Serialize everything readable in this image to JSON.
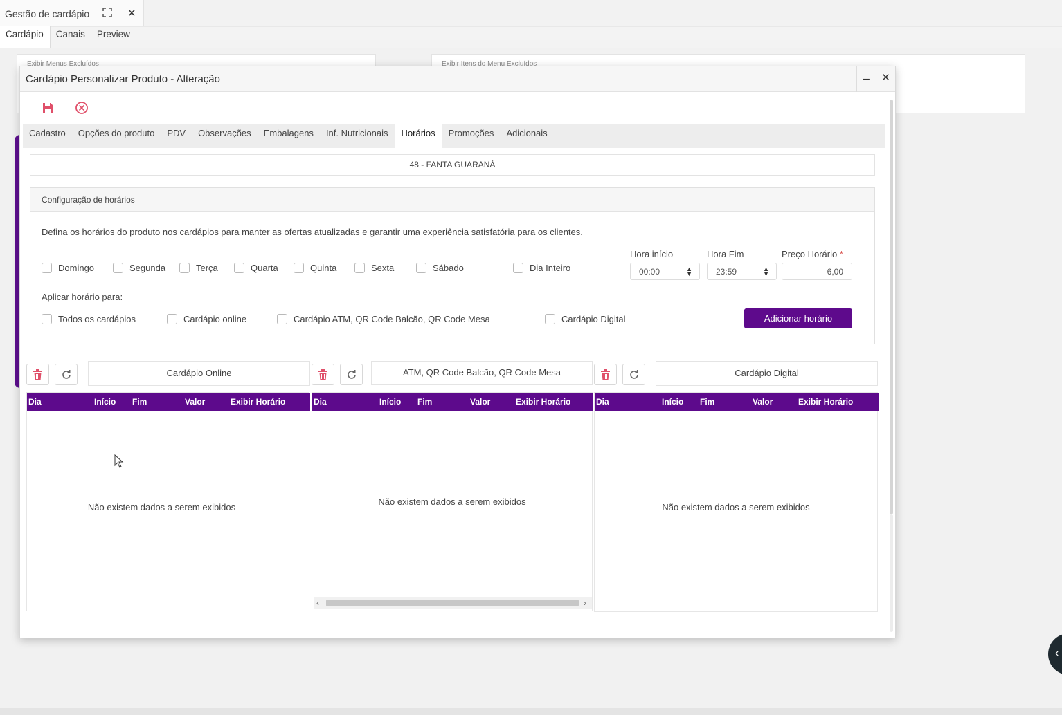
{
  "app_tab": {
    "title": "Gestão de cardápio"
  },
  "outer_tabs": [
    "Cardápio",
    "Canais",
    "Preview"
  ],
  "background_panels": {
    "left_header": "Exibir Menus Excluídos",
    "right_header": "Exibir Itens do Menu Excluídos"
  },
  "modal": {
    "title": "Cardápio Personalizar Produto - Alteração",
    "tabs": [
      "Cadastro",
      "Opções do produto",
      "PDV",
      "Observações",
      "Embalagens",
      "Inf. Nutricionais",
      "Horários",
      "Promoções",
      "Adicionais"
    ],
    "active_tab": "Horários",
    "product": "48 - FANTA GUARANÁ",
    "config": {
      "header": "Configuração de horários",
      "description": "Defina os horários do produto nos cardápios para manter as ofertas atualizadas e garantir uma experiência satisfatória para os clientes.",
      "days": [
        "Domingo",
        "Segunda",
        "Terça",
        "Quarta",
        "Quinta",
        "Sexta",
        "Sábado",
        "Dia Inteiro"
      ],
      "hora_inicio_label": "Hora início",
      "hora_inicio": "00:00",
      "hora_fim_label": "Hora Fim",
      "hora_fim": "23:59",
      "preco_label": "Preço Horário",
      "preco_required": "*",
      "preco": "6,00",
      "apply_label": "Aplicar horário para:",
      "targets": [
        "Todos os cardápios",
        "Cardápio online",
        "Cardápio ATM, QR Code Balcão, QR Code Mesa",
        "Cardápio Digital"
      ],
      "add_button": "Adicionar horário"
    },
    "lists": [
      {
        "title": "Cardápio Online",
        "empty": "Não existem dados a serem exibidos"
      },
      {
        "title": "ATM, QR Code Balcão, QR Code Mesa",
        "empty": "Não existem dados a serem exibidos"
      },
      {
        "title": "Cardápio Digital",
        "empty": "Não existem dados a serem exibidos"
      }
    ],
    "columns": [
      "Dia",
      "Início",
      "Fim",
      "Valor",
      "Exibir Horário"
    ]
  },
  "colors": {
    "accent": "#5d0a8c",
    "danger": "#e0506a",
    "save_icon": "#e0506a"
  }
}
